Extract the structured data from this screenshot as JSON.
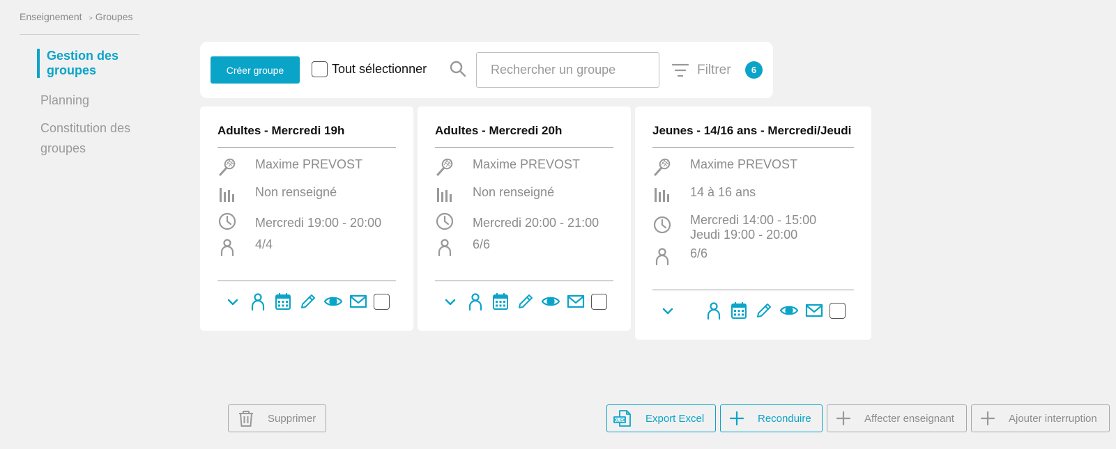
{
  "breadcrumb": {
    "item1": "Enseignement",
    "separator": ">",
    "item2": "Groupes"
  },
  "sidebar": {
    "items": [
      {
        "label": "Gestion des groupes"
      },
      {
        "label": "Planning"
      },
      {
        "label": "Constitution des groupes"
      }
    ]
  },
  "toolbar": {
    "create_label": "Créer groupe",
    "select_all_label": "Tout sélectionner",
    "search_placeholder": "Rechercher un groupe",
    "filter_label": "Filtrer",
    "filter_count": "6"
  },
  "cards": [
    {
      "title": "Adultes - Mercredi 19h",
      "teacher": "Maxime PREVOST",
      "level": "Non renseigné",
      "schedule": [
        "Mercredi 19:00 - 20:00"
      ],
      "capacity": "4/4"
    },
    {
      "title": "Adultes - Mercredi 20h",
      "teacher": "Maxime PREVOST",
      "level": "Non renseigné",
      "schedule": [
        "Mercredi 20:00 - 21:00"
      ],
      "capacity": "6/6"
    },
    {
      "title": "Jeunes - 14/16 ans - Mercredi/Jeudi",
      "teacher": "Maxime PREVOST",
      "level": "14 à 16 ans",
      "schedule": [
        "Mercredi 14:00 - 15:00",
        "Jeudi 19:00 - 20:00"
      ],
      "capacity": "6/6"
    }
  ],
  "bottom": {
    "delete_label": "Supprimer",
    "export_label": "Export Excel",
    "renew_label": "Reconduire",
    "assign_label": "Affecter enseignant",
    "interrupt_label": "Ajouter interruption"
  },
  "icons": {
    "teacher": "racket-icon",
    "level": "bar-chart-icon",
    "schedule": "clock-icon",
    "capacity": "person-icon",
    "actions": [
      "chevron-down-icon",
      "person-icon",
      "calendar-icon",
      "pencil-icon",
      "eye-icon",
      "mail-icon"
    ]
  },
  "colors": {
    "accent": "#0aa4c9",
    "muted": "#8c8c8c",
    "background": "#f1f1f1"
  }
}
